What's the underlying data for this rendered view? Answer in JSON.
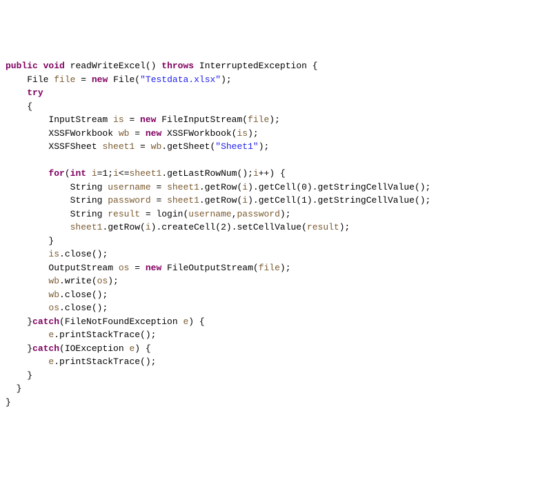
{
  "code": {
    "kw_public": "public",
    "kw_void": "void",
    "method_name": "readWriteExcel",
    "kw_throws": "throws",
    "ex_interrupted": "InterruptedException",
    "lbrace": "{",
    "rbrace": "}",
    "type_file": "File",
    "var_file": "file",
    "eq": "=",
    "kw_new": "new",
    "ctor_file": "File",
    "str_testdata": "\"Testdata.xlsx\"",
    "semi": ";",
    "kw_try": "try",
    "type_inputstream": "InputStream",
    "var_is": "is",
    "ctor_fis": "FileInputStream",
    "arg_file": "file",
    "type_xssfworkbook": "XSSFWorkbook",
    "var_wb": "wb",
    "ctor_xssfworkbook": "XSSFWorkbook",
    "arg_is": "is",
    "type_xssfsheet": "XSSFSheet",
    "var_sheet1": "sheet1",
    "call_getsheet": "wb.getSheet",
    "str_sheet1": "\"Sheet1\"",
    "kw_for": "for",
    "kw_int": "int",
    "for_init": "i=1;i<=sheet1.getLastRowNum();i++",
    "for_var": "i",
    "type_string": "String",
    "var_username": "username",
    "call_getrow_un": "sheet1.getRow(i).getCell(0).getStringCellValue()",
    "var_password": "password",
    "call_getrow_pw": "sheet1.getRow(i).getCell(1).getStringCellValue()",
    "var_result": "result",
    "call_login": "login(username,password)",
    "call_setcellvalue": "sheet1.getRow(i).createCell(2).setCellValue",
    "arg_result": "result",
    "call_is_close": "is.close()",
    "type_outputstream": "OutputStream",
    "var_os": "os",
    "ctor_fos": "FileOutputStream",
    "call_wb_write": "wb.write",
    "arg_os": "os",
    "call_wb_close": "wb.close()",
    "call_os_close": "os.close()",
    "kw_catch": "catch",
    "ex_fnf": "FileNotFoundException",
    "var_e": "e",
    "call_pst": "e.printStackTrace()",
    "ex_io": "IOException"
  }
}
